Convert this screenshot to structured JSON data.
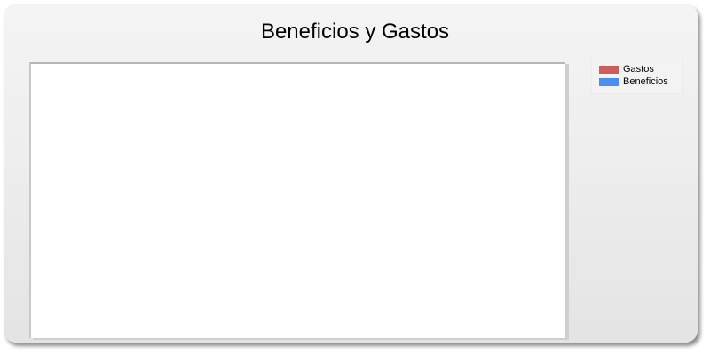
{
  "chart_data": {
    "type": "bar",
    "title": "Beneficios y Gastos",
    "categories": [],
    "series": [
      {
        "name": "Gastos",
        "values": [],
        "color": "#cd5c5c"
      },
      {
        "name": "Beneficios",
        "values": [],
        "color": "#4a8ff0"
      }
    ],
    "legend": {
      "placement": "right"
    },
    "grid": false
  }
}
